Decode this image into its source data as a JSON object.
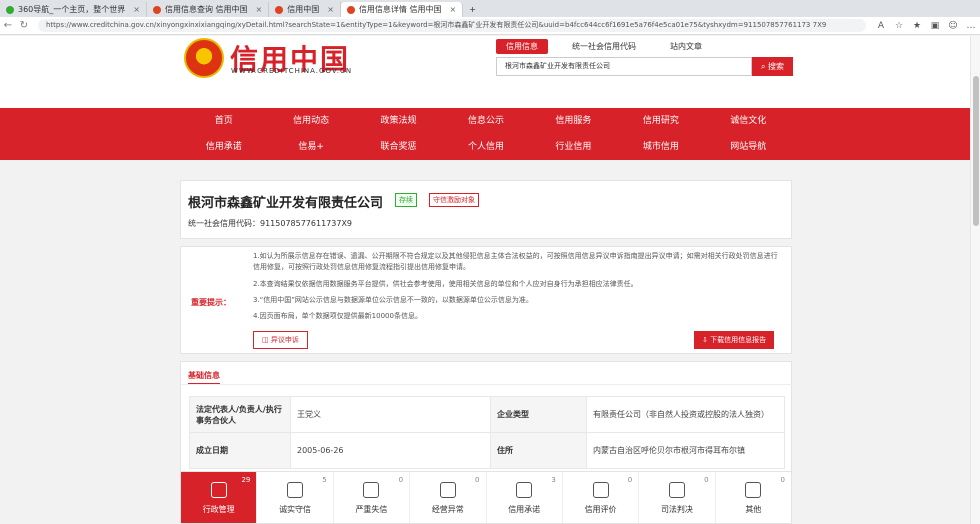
{
  "browser": {
    "tabs": [
      {
        "label": "360导航_一个主页，整个世界",
        "active": false
      },
      {
        "label": "信用信息查询 信用中国",
        "active": false
      },
      {
        "label": "信用中国",
        "active": false
      },
      {
        "label": "信用信息详情 信用中国",
        "active": true
      }
    ],
    "url": "https://www.creditchina.gov.cn/xinyongxinxixiangqing/xyDetail.html?searchState=1&entityType=1&keyword=根河市森鑫矿业开发有限责任公司&uuid=b4fcc644cc6f1691e5a76f4e5ca01e75&tyshxydm=911507857761173 7X9"
  },
  "header": {
    "logo_text": "信用中国",
    "logo_sub": "WWW.CREDITCHINA.GOV.CN",
    "search_tabs": [
      "信用信息",
      "统一社会信用代码",
      "站内文章"
    ],
    "search_value": "根河市森鑫矿业开发有限责任公司",
    "search_button": "搜索"
  },
  "nav": {
    "row1": [
      "首页",
      "信用动态",
      "政策法规",
      "信息公示",
      "信用服务",
      "信用研究",
      "诚信文化"
    ],
    "row2": [
      "信用承诺",
      "信易+",
      "联合奖惩",
      "个人信用",
      "行业信用",
      "城市信用",
      "网站导航"
    ]
  },
  "company": {
    "name": "根河市森鑫矿业开发有限责任公司",
    "status_badge": "存续",
    "flag_badge": "守信激励对象",
    "credit_code_label": "统一社会信用代码：",
    "credit_code": "9115078577611737X9"
  },
  "notice": {
    "title": "重要提示：",
    "lines": [
      "1.如认为所展示信息存在错误、遗漏、公开期限不符合规定以及其他侵犯信息主体合法权益的，可按照信用信息异议申诉指南提出异议申请；如需对相关行政处罚信息进行信用修复，可按照行政处罚信息信用修复流程指引提出信用修复申请。",
      "2.本查询结果仅依据信用数据服务平台提供，供社会参考使用，使用相关信息的单位和个人应对自身行为承担相应法律责任。",
      "3.“信用中国”网站公示信息与数据源单位公示信息不一致的，以数据源单位公示信息为准。",
      "4.因页面布局，单个数据项仅提供最新10000条信息。"
    ],
    "appeal_button": "异议申诉",
    "download_button": "下载信用信息报告"
  },
  "basic": {
    "title": "基础信息",
    "rows": [
      {
        "k1": "法定代表人/负责人/执行事务合伙人",
        "v1": "王党义",
        "k2": "企业类型",
        "v2": "有限责任公司（非自然人投资或控股的法人独资）"
      },
      {
        "k1": "成立日期",
        "v1": "2005-06-26",
        "k2": "住所",
        "v2": "内蒙古自治区呼伦贝尔市根河市得耳布尔镇"
      }
    ]
  },
  "categories": [
    {
      "label": "行政管理",
      "count": "29",
      "icon": "document-icon"
    },
    {
      "label": "诚实守信",
      "count": "5",
      "icon": "shield-icon"
    },
    {
      "label": "严重失信",
      "count": "0",
      "icon": "warning-icon"
    },
    {
      "label": "经营异常",
      "count": "0",
      "icon": "alarm-icon"
    },
    {
      "label": "信用承诺",
      "count": "3",
      "icon": "promise-icon"
    },
    {
      "label": "信用评价",
      "count": "0",
      "icon": "rating-icon"
    },
    {
      "label": "司法判决",
      "count": "0",
      "icon": "judgment-icon"
    },
    {
      "label": "其他",
      "count": "0",
      "icon": "other-icon"
    }
  ]
}
